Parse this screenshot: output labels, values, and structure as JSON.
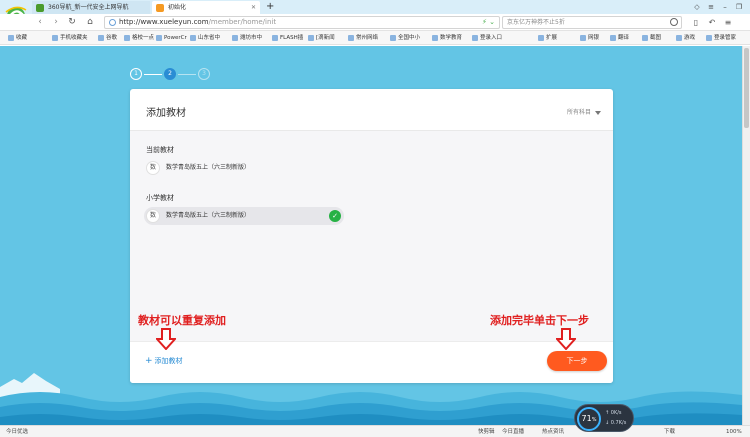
{
  "browser": {
    "tabs": [
      {
        "label": "360导航_新一代安全上网导航",
        "active": false
      },
      {
        "label": "初始化",
        "active": true
      }
    ],
    "url_host": "http://www.xueleyun.com",
    "url_path": "/member/home/init",
    "search_placeholder": "京东亿万神券不止5折",
    "bookmarks": [
      "收藏",
      "手机收藏夹",
      "谷歌",
      "格校一点",
      "PowerCr",
      "山东省中",
      "潍坊市中",
      "FLASH插",
      "[滴新闻",
      "常州网络",
      "全国中小",
      "数学教育",
      "登录入口",
      "扩展",
      "网银",
      "翻译",
      "截图",
      "游戏",
      "登录管家"
    ],
    "status": {
      "left": "今日优选",
      "items": [
        "快剪辑",
        "今日直播",
        "热点资讯",
        "下载",
        "100%"
      ],
      "speed": "71",
      "speed_unit": "%",
      "up": "0K/s",
      "down": "0.7K/s"
    }
  },
  "steps": [
    "1",
    "2",
    "3"
  ],
  "card": {
    "title": "添加教材",
    "subject_filter": "所有科目",
    "current_section": "当前教材",
    "current_item": {
      "badge": "数",
      "label": "数学青岛版五上（六三制新版）"
    },
    "primary_section": "小学教材",
    "primary_item": {
      "badge": "数",
      "label": "数学青岛版五上（六三制新版）",
      "checked": true
    },
    "add_link": "添加教材",
    "next_button": "下一步"
  },
  "annotations": {
    "left": "教材可以重复添加",
    "right": "添加完毕单击下一步"
  },
  "colors": {
    "page_bg": "#63c5e5",
    "accent": "#2a8dd4",
    "next_button": "#ff5a1f",
    "check": "#27b145",
    "annotation": "#e02020"
  }
}
